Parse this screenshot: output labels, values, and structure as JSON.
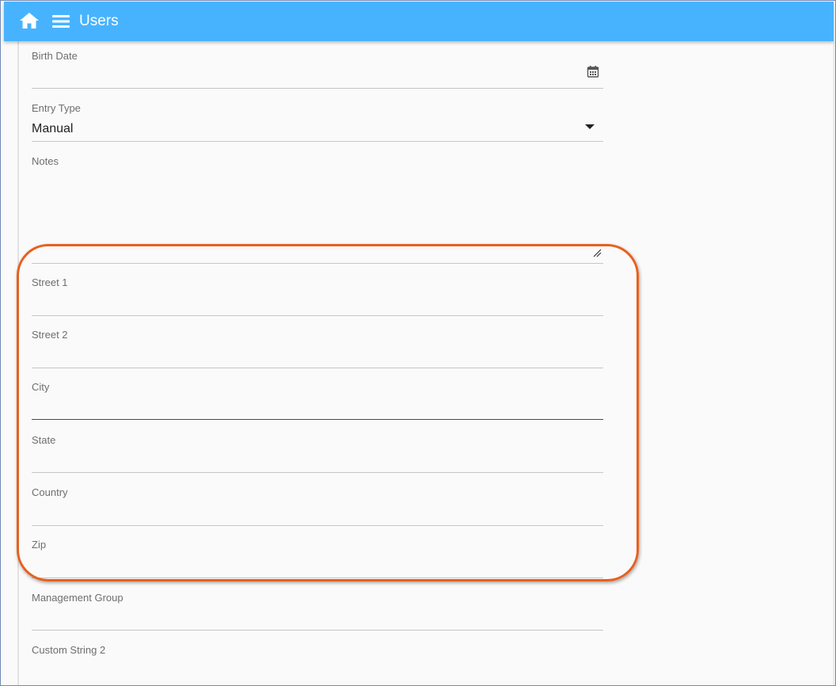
{
  "header": {
    "title": "Users",
    "home_icon": "home-icon",
    "menu_icon": "hamburger-menu-icon",
    "color": "#47b3ff"
  },
  "form": {
    "birth_date": {
      "label": "Birth Date",
      "value": "",
      "icon": "calendar-icon"
    },
    "entry_type": {
      "label": "Entry Type",
      "value": "Manual",
      "icon": "dropdown-arrow-icon"
    },
    "notes": {
      "label": "Notes",
      "value": "",
      "icon": "resize-handle-icon"
    },
    "street1": {
      "label": "Street 1",
      "value": ""
    },
    "street2": {
      "label": "Street 2",
      "value": ""
    },
    "city": {
      "label": "City",
      "value": ""
    },
    "state": {
      "label": "State",
      "value": ""
    },
    "country": {
      "label": "Country",
      "value": ""
    },
    "zip": {
      "label": "Zip",
      "value": ""
    },
    "management_group": {
      "label": "Management Group",
      "value": ""
    },
    "custom_string_2": {
      "label": "Custom String 2",
      "value": ""
    }
  },
  "annotation": {
    "highlight_color": "#e8601e"
  }
}
